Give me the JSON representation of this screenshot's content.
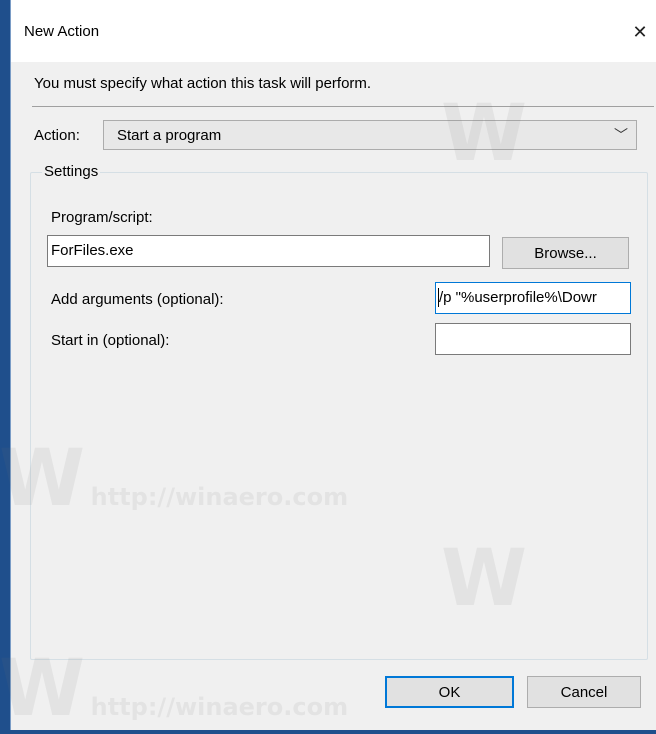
{
  "dialog": {
    "title": "New Action",
    "close_glyph": "✕",
    "description": "You must specify what action this task will perform."
  },
  "action": {
    "label": "Action:",
    "selected": "Start a program",
    "chevron": "﹀"
  },
  "settings": {
    "legend": "Settings",
    "program_label": "Program/script:",
    "program_value": "ForFiles.exe",
    "browse_label": "Browse...",
    "arguments_label": "Add arguments (optional):",
    "arguments_value": "/p \"%userprofile%\\Dowr",
    "start_in_label": "Start in (optional):",
    "start_in_value": ""
  },
  "buttons": {
    "ok_label": "OK",
    "cancel_label": "Cancel"
  },
  "watermark": {
    "letter": "W",
    "url": "http://winaero.com"
  }
}
